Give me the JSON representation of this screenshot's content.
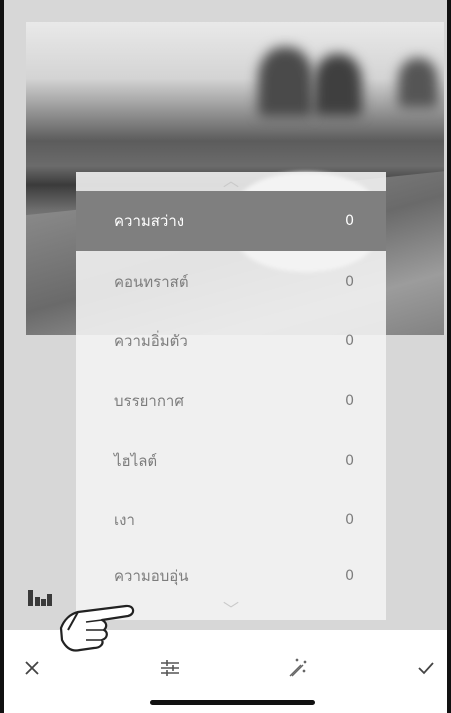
{
  "adjustments": {
    "items": [
      {
        "label": "ความสว่าง",
        "value": "0",
        "selected": true
      },
      {
        "label": "คอนทราสต์",
        "value": "0",
        "selected": false
      },
      {
        "label": "ความอิ่มตัว",
        "value": "0",
        "selected": false
      },
      {
        "label": "บรรยากาศ",
        "value": "0",
        "selected": false
      },
      {
        "label": "ไฮไลต์",
        "value": "0",
        "selected": false
      },
      {
        "label": "เงา",
        "value": "0",
        "selected": false
      },
      {
        "label": "ความอบอุ่น",
        "value": "0",
        "selected": false
      }
    ]
  },
  "icons": {
    "panel_up": "chevron-up-icon",
    "panel_down": "chevron-down-icon",
    "histogram": "histogram-icon",
    "cancel": "close-icon",
    "adjust": "sliders-icon",
    "auto": "magic-wand-icon",
    "apply": "checkmark-icon",
    "pointer": "pointing-hand-icon"
  },
  "colors": {
    "selected_row": "#7f7f7f",
    "panel": "#f4f4f4",
    "editor_bg": "#d7d7d7"
  }
}
